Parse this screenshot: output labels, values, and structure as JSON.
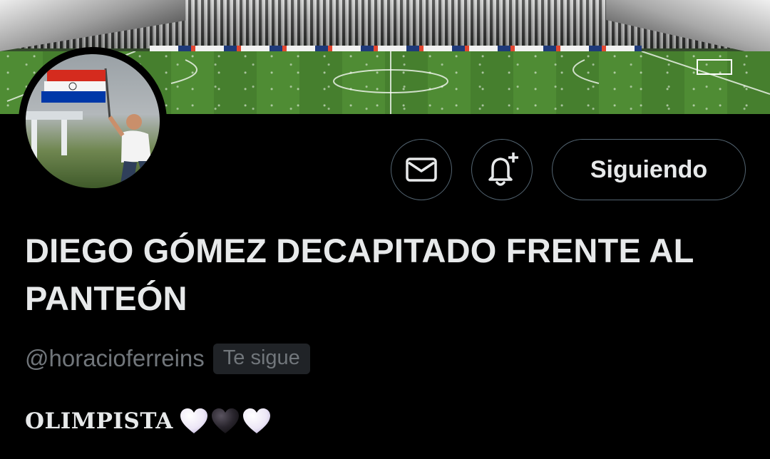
{
  "profile": {
    "display_name": "DIEGO GÓMEZ DECAPITADO FRENTE AL PANTEÓN",
    "handle": "@horacioferreins",
    "follows_you_badge": "Te sigue",
    "bio_text": "OLIMPISTA",
    "bio_emojis": [
      "white-heart",
      "black-heart",
      "white-heart"
    ]
  },
  "actions": {
    "message_icon": "envelope-icon",
    "notify_icon": "bell-plus-icon",
    "follow_label": "Siguiendo"
  },
  "theme": {
    "background": "#000000",
    "text_primary": "#e7e9ea",
    "text_secondary": "#71767b",
    "border": "#536471",
    "badge_bg": "#202327"
  }
}
